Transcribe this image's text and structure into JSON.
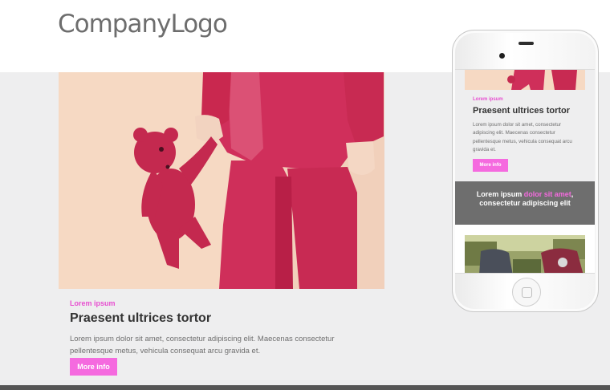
{
  "header": {
    "logo_text": "CompanyLogo"
  },
  "card": {
    "eyebrow": "Lorem ipsum",
    "title": "Praesent ultrices tortor",
    "body": "Lorem ipsum dolor sit amet, consectetur adipiscing elit. Maecenas consectetur pellentesque metus, vehicula consequat arcu gravida et.",
    "button_label": "More info"
  },
  "mobile_preview": {
    "eyebrow": "Lorem ipsum",
    "title": "Praesent ultrices tortor",
    "body": "Lorem ipsum dolor sit amet, consectetur adipiscing elit. Maecenas consectetur pellentesque metus, vehicula consequat arcu gravida et.",
    "button_label": "More info",
    "banner": {
      "text_plain": "Lorem ipsum",
      "text_highlight": "dolor sit amet",
      "text_rest": ", consectetur adipiscing elit"
    }
  },
  "colors": {
    "accent": "#f56adf",
    "eyebrow": "#e74fd0",
    "background": "#eeeeef",
    "banner": "#6e6e6e"
  }
}
